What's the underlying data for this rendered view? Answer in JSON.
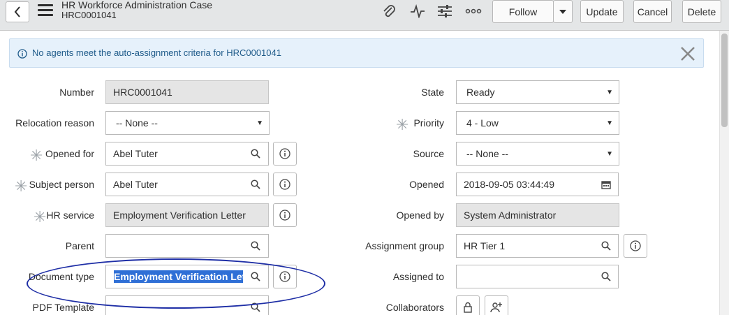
{
  "header": {
    "title": "HR Workforce Administration Case",
    "subtitle": "HRC0001041",
    "buttons": {
      "follow": "Follow",
      "update": "Update",
      "cancel": "Cancel",
      "delete": "Delete"
    },
    "icons": [
      "paperclip-icon",
      "activity-icon",
      "settings-sliders-icon",
      "more-icon"
    ]
  },
  "banner": {
    "message": "No agents meet the auto-assignment criteria for HRC0001041"
  },
  "form": {
    "left": {
      "number": {
        "label": "Number",
        "value": "HRC0001041"
      },
      "relocation_reason": {
        "label": "Relocation reason",
        "value": "-- None --"
      },
      "opened_for": {
        "label": "Opened for",
        "value": "Abel Tuter"
      },
      "subject_person": {
        "label": "Subject person",
        "value": "Abel Tuter"
      },
      "hr_service": {
        "label": "HR service",
        "value": "Employment Verification Letter"
      },
      "parent": {
        "label": "Parent",
        "value": ""
      },
      "document_type": {
        "label": "Document type",
        "value": "Employment Verification Lette"
      },
      "pdf_template": {
        "label": "PDF Template",
        "value": ""
      }
    },
    "right": {
      "state": {
        "label": "State",
        "value": "Ready"
      },
      "priority": {
        "label": "Priority",
        "value": "4 - Low"
      },
      "source": {
        "label": "Source",
        "value": "-- None --"
      },
      "opened": {
        "label": "Opened",
        "value": "2018-09-05 03:44:49"
      },
      "opened_by": {
        "label": "Opened by",
        "value": "System Administrator"
      },
      "assignment_group": {
        "label": "Assignment group",
        "value": "HR Tier 1"
      },
      "assigned_to": {
        "label": "Assigned to",
        "value": ""
      },
      "collaborators": {
        "label": "Collaborators"
      }
    }
  },
  "colors": {
    "header_bg": "#e4e6e7",
    "banner_bg": "#e6f1fb",
    "banner_text": "#1f5b8a",
    "selection": "#2f6fd6",
    "annotation": "#1f2fa6"
  }
}
